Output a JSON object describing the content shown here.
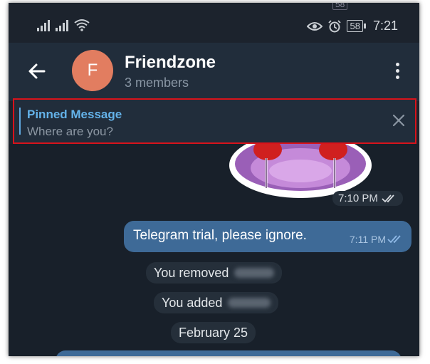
{
  "statusbar": {
    "time": "7:21",
    "battery": "58",
    "top_battery_ghost": "58"
  },
  "header": {
    "avatar_letter": "F",
    "title": "Friendzone",
    "subtitle": "3 members"
  },
  "pinned": {
    "title": "Pinned Message",
    "text": "Where are you?"
  },
  "messages": {
    "sticker_time": "7:10 PM",
    "outgoing_text": "Telegram trial, please ignore.",
    "outgoing_time": "7:11 PM",
    "service_removed": "You removed",
    "service_added": "You added",
    "date_separator": "February 25"
  },
  "colors": {
    "pinned_highlight": "#d8131b",
    "accent": "#64b3ea",
    "avatar": "#e27d60",
    "outgoing_bubble": "#3e6a97"
  },
  "icons": [
    "back-arrow-icon",
    "more-vert-icon",
    "close-icon",
    "eye-icon",
    "alarm-icon",
    "wifi-icon",
    "signal-icon",
    "double-check-icon",
    "battery-icon"
  ]
}
